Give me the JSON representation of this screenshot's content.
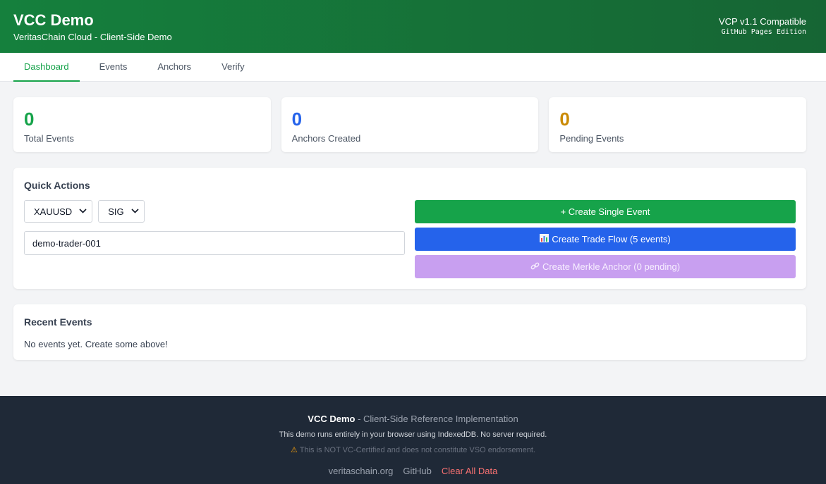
{
  "header": {
    "title": "VCC Demo",
    "subtitle": "VeritasChain Cloud - Client-Side Demo",
    "compat": "VCP v1.1 Compatible",
    "edition": "GitHub Pages Edition"
  },
  "tabs": [
    {
      "label": "Dashboard",
      "active": true
    },
    {
      "label": "Events",
      "active": false
    },
    {
      "label": "Anchors",
      "active": false
    },
    {
      "label": "Verify",
      "active": false
    }
  ],
  "stats": [
    {
      "value": "0",
      "label": "Total Events",
      "color": "#16a34a"
    },
    {
      "value": "0",
      "label": "Anchors Created",
      "color": "#2563eb"
    },
    {
      "value": "0",
      "label": "Pending Events",
      "color": "#ca8a04"
    }
  ],
  "quick_actions": {
    "title": "Quick Actions",
    "symbol_select": "XAUUSD",
    "type_select": "SIG",
    "trader_input": "demo-trader-001",
    "create_single": "+ Create Single Event",
    "create_flow": "Create Trade Flow (5 events)",
    "create_anchor": "Create Merkle Anchor (0 pending)"
  },
  "recent_events": {
    "title": "Recent Events",
    "empty": "No events yet. Create some above!"
  },
  "footer": {
    "brand": "VCC Demo",
    "tagline": " - Client-Side Reference Implementation",
    "note": "This demo runs entirely in your browser using IndexedDB. No server required.",
    "disclaimer": "This is NOT VC-Certified and does not constitute VSO endorsement.",
    "links": {
      "site": "veritaschain.org",
      "github": "GitHub",
      "clear": "Clear All Data"
    }
  },
  "colors": {
    "brand_green": "#16a34a",
    "header_green": "#15803d",
    "blue": "#2563eb",
    "purple_disabled": "#c89ff0",
    "amber": "#ca8a04",
    "danger": "#f87171",
    "footer_bg": "#1f2937"
  },
  "icons": {
    "trade_flow": "bar-chart-icon",
    "anchor": "link-icon",
    "warning": "warning-icon"
  }
}
